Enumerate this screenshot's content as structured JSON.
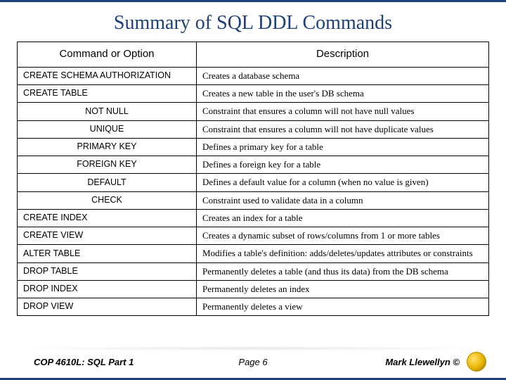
{
  "title": "Summary of SQL DDL Commands",
  "headers": {
    "cmd": "Command or Option",
    "desc": "Description"
  },
  "rows": [
    {
      "cmd": "CREATE SCHEMA AUTHORIZATION",
      "indent": false,
      "desc": "Creates a database schema"
    },
    {
      "cmd": "CREATE TABLE",
      "indent": false,
      "desc": "Creates a new table in the user's DB schema"
    },
    {
      "cmd": "NOT NULL",
      "indent": true,
      "desc": "Constraint that ensures a column will not have null values"
    },
    {
      "cmd": "UNIQUE",
      "indent": true,
      "desc": "Constraint that ensures a column will not have duplicate values"
    },
    {
      "cmd": "PRIMARY KEY",
      "indent": true,
      "desc": "Defines a primary key for a table"
    },
    {
      "cmd": "FOREIGN KEY",
      "indent": true,
      "desc": "Defines a foreign key for a table"
    },
    {
      "cmd": "DEFAULT",
      "indent": true,
      "desc": "Defines a default value for a column (when no value is given)"
    },
    {
      "cmd": "CHECK",
      "indent": true,
      "desc": "Constraint used to validate data in a column"
    },
    {
      "cmd": "CREATE INDEX",
      "indent": false,
      "desc": "Creates an index for a table"
    },
    {
      "cmd": "CREATE VIEW",
      "indent": false,
      "desc": "Creates a dynamic subset of rows/columns from 1 or more tables"
    },
    {
      "cmd": "ALTER TABLE",
      "indent": false,
      "desc": "Modifies a table's definition: adds/deletes/updates attributes or constraints"
    },
    {
      "cmd": "DROP TABLE",
      "indent": false,
      "desc": "Permanently deletes a table (and thus its data) from the DB schema"
    },
    {
      "cmd": "DROP INDEX",
      "indent": false,
      "desc": "Permanently deletes an index"
    },
    {
      "cmd": "DROP VIEW",
      "indent": false,
      "desc": "Permanently deletes a view"
    }
  ],
  "footer": {
    "course": "COP 4610L: SQL Part 1",
    "page": "Page 6",
    "author": "Mark Llewellyn ©"
  }
}
